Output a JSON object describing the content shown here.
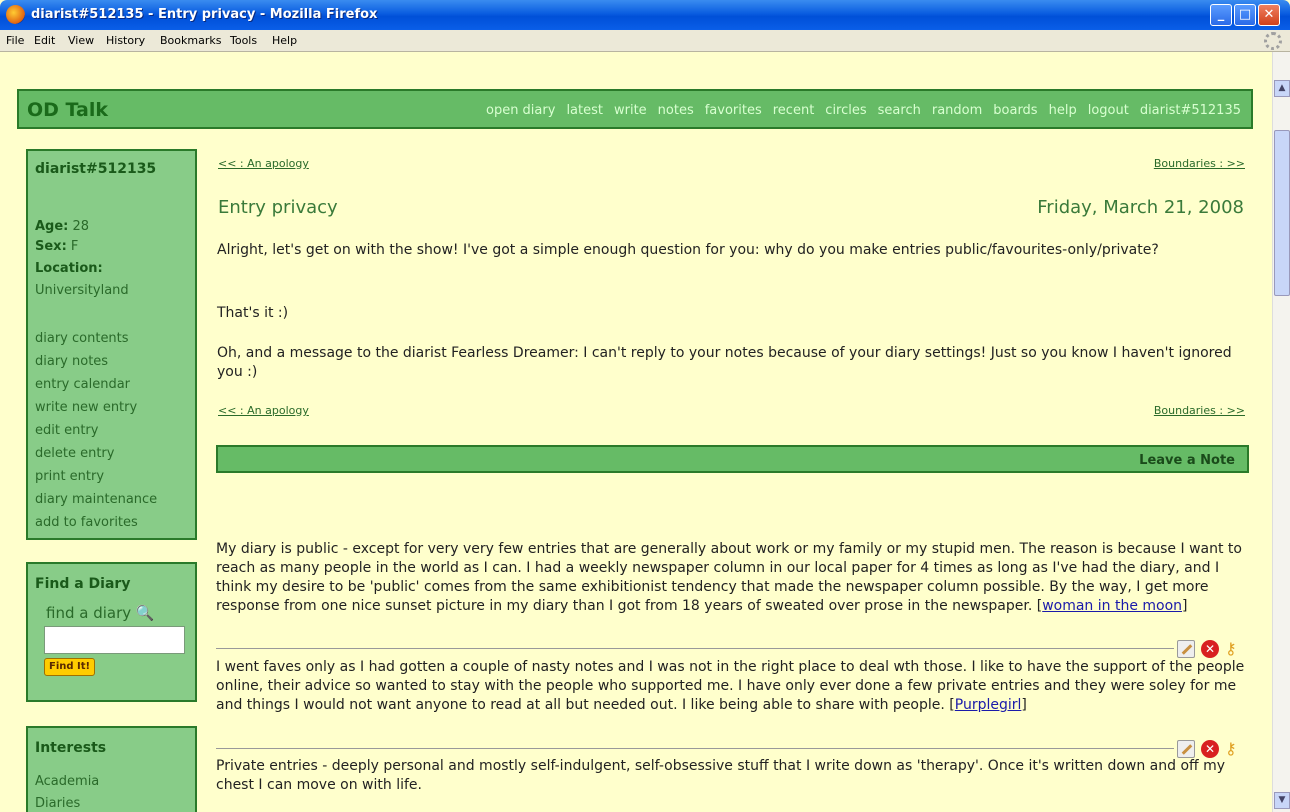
{
  "window": {
    "title": "diarist#512135 - Entry privacy - Mozilla Firefox",
    "controls": [
      "_",
      "□",
      "✕"
    ]
  },
  "menu": [
    "File",
    "Edit",
    "View",
    "History",
    "Bookmarks",
    "Tools",
    "Help"
  ],
  "header": {
    "brand": "OD Talk",
    "nav": [
      "open diary",
      "latest",
      "write",
      "notes",
      "favorites",
      "recent",
      "circles",
      "search",
      "random",
      "boards",
      "help",
      "logout",
      "diarist#512135"
    ]
  },
  "profile": {
    "username": "diarist#512135",
    "age_label": "Age:",
    "age": "28",
    "sex_label": "Sex:",
    "sex": "F",
    "location_label": "Location:",
    "location": "Universityland",
    "links": [
      "diary contents",
      "diary notes",
      "entry calendar",
      "write new entry",
      "edit entry",
      "delete entry",
      "print entry",
      "diary maintenance",
      "add to favorites"
    ]
  },
  "find": {
    "title": "Find a Diary",
    "label": "find a diary",
    "button": "Find It!"
  },
  "interests": {
    "title": "Interests",
    "items": [
      "Academia",
      "Diaries"
    ]
  },
  "entry": {
    "prev": "<< : An apology",
    "next": "Boundaries : >>",
    "title": "Entry privacy",
    "date": "Friday, March 21, 2008",
    "paragraphs": [
      "Alright, let's get on with the show! I've got a simple enough question for you: why do you make entries public/favourites-only/private?",
      "That's it :)",
      "Oh, and a message to the diarist Fearless Dreamer: I can't reply to your notes because of your diary settings! Just so you know I haven't ignored you :)"
    ]
  },
  "notes": {
    "bar_label": "Leave a Note",
    "items": [
      {
        "text": "My diary is public - except for very very few entries that are generally about work or my family or my stupid men. The reason is because I want to reach as many people in the world as I can. I had a weekly newspaper column in our local paper for 4 times as long as I've had the diary, and I think my desire to be 'public' comes from the same exhibitionist tendency that made the newspaper column possible. By the way, I get more response from one nice sunset picture in my diary than I got from 18 years of sweated over prose in the newspaper.",
        "author": "woman in the moon"
      },
      {
        "text": "I went faves only as I had gotten a couple of nasty notes and I was not in the right place to deal wth those. I like to have the support of the people online, their advice so wanted to stay with the people who supported me. I have only ever done a few private entries and they were soley for me and things I would not want anyone to read at all but needed out. I like being able to share with people.",
        "author": "Purplegirl"
      },
      {
        "text": "Private entries - deeply personal and mostly self-indulgent, self-obsessive stuff that I write down as 'therapy'. Once it's written down and off my chest I can move on with life.",
        "author": ""
      }
    ]
  }
}
